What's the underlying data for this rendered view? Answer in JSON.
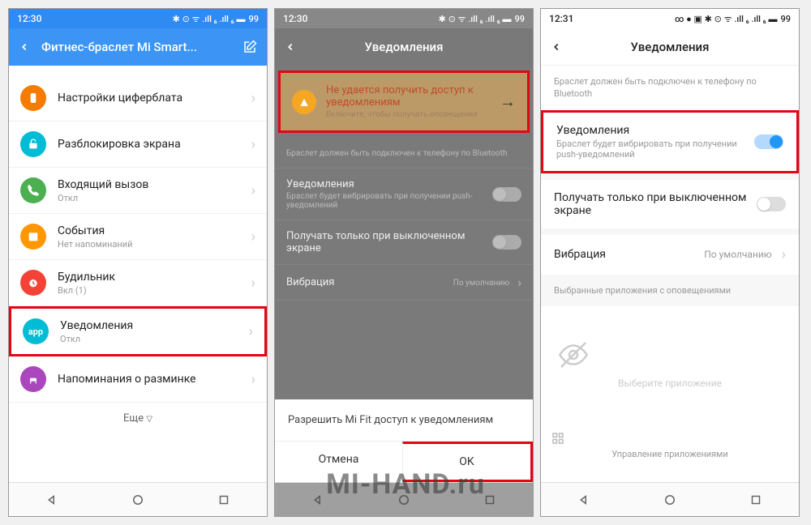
{
  "watermark": "MI-HAND.ru",
  "screen1": {
    "time": "12:30",
    "battery": "99",
    "title": "Фитнес-браслет Mi Smart...",
    "items": [
      {
        "title": "Настройки циферблата",
        "sub": "",
        "icon": "ic-orange"
      },
      {
        "title": "Разблокировка экрана",
        "sub": "",
        "icon": "ic-cyan"
      },
      {
        "title": "Входящий вызов",
        "sub": "Откл",
        "icon": "ic-green"
      },
      {
        "title": "События",
        "sub": "Нет напоминаний",
        "icon": "ic-orange2"
      },
      {
        "title": "Будильник",
        "sub": "Вкл (1)",
        "icon": "ic-red"
      },
      {
        "title": "Уведомления",
        "sub": "Откл",
        "icon": "ic-app",
        "hl": true,
        "iconText": "app"
      },
      {
        "title": "Напоминания о разминке",
        "sub": "",
        "icon": "ic-purple"
      }
    ],
    "more": "Еще"
  },
  "screen2": {
    "time": "12:30",
    "battery": "99",
    "title": "Уведомления",
    "alert": {
      "title": "Не удается получить доступ к уведомлениям",
      "sub": "Включите, чтобы получать оповещения"
    },
    "info": "Браслет должен быть подключен к телефону по Bluetooth",
    "rows": [
      {
        "title": "Уведомления",
        "sub": "Браслет будет вибрировать при получении push-уведомлений"
      },
      {
        "title": "Получать только при выключенном экране",
        "sub": ""
      }
    ],
    "vib": {
      "label": "Вибрация",
      "value": "По умолчанию"
    },
    "dialog": {
      "msg": "Разрешить Mi Fit доступ к уведомлениям",
      "cancel": "Отмена",
      "ok": "OK"
    }
  },
  "screen3": {
    "time": "12:31",
    "battery": "99",
    "title": "Уведомления",
    "info": "Браслет должен быть подключен к телефону по Bluetooth",
    "rows": [
      {
        "title": "Уведомления",
        "sub": "Браслет будет вибрировать при получении push-уведомлений",
        "on": true,
        "hl": true
      },
      {
        "title": "Получать только при выключенном экране",
        "sub": "",
        "on": false
      }
    ],
    "vib": {
      "label": "Вибрация",
      "value": "По умолчанию"
    },
    "section": "Выбранные приложения с оповещениями",
    "empty": "Выберите приложение",
    "manage": "Управление приложениями"
  }
}
